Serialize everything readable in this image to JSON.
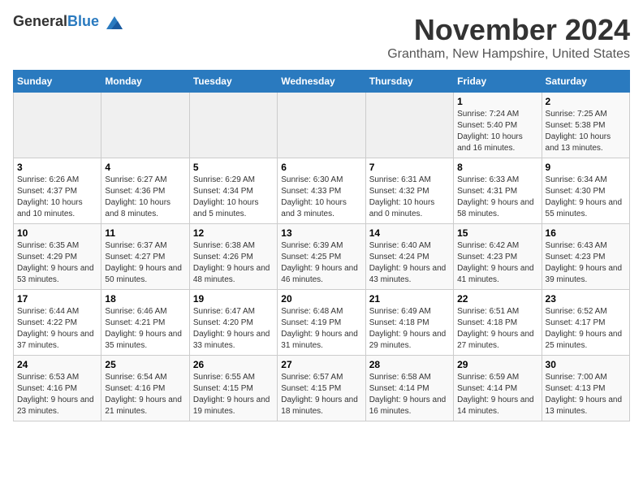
{
  "header": {
    "logo_general": "General",
    "logo_blue": "Blue",
    "month_title": "November 2024",
    "location": "Grantham, New Hampshire, United States"
  },
  "weekdays": [
    "Sunday",
    "Monday",
    "Tuesday",
    "Wednesday",
    "Thursday",
    "Friday",
    "Saturday"
  ],
  "weeks": [
    [
      {
        "day": "",
        "info": ""
      },
      {
        "day": "",
        "info": ""
      },
      {
        "day": "",
        "info": ""
      },
      {
        "day": "",
        "info": ""
      },
      {
        "day": "",
        "info": ""
      },
      {
        "day": "1",
        "info": "Sunrise: 7:24 AM\nSunset: 5:40 PM\nDaylight: 10 hours and 16 minutes."
      },
      {
        "day": "2",
        "info": "Sunrise: 7:25 AM\nSunset: 5:38 PM\nDaylight: 10 hours and 13 minutes."
      }
    ],
    [
      {
        "day": "3",
        "info": "Sunrise: 6:26 AM\nSunset: 4:37 PM\nDaylight: 10 hours and 10 minutes."
      },
      {
        "day": "4",
        "info": "Sunrise: 6:27 AM\nSunset: 4:36 PM\nDaylight: 10 hours and 8 minutes."
      },
      {
        "day": "5",
        "info": "Sunrise: 6:29 AM\nSunset: 4:34 PM\nDaylight: 10 hours and 5 minutes."
      },
      {
        "day": "6",
        "info": "Sunrise: 6:30 AM\nSunset: 4:33 PM\nDaylight: 10 hours and 3 minutes."
      },
      {
        "day": "7",
        "info": "Sunrise: 6:31 AM\nSunset: 4:32 PM\nDaylight: 10 hours and 0 minutes."
      },
      {
        "day": "8",
        "info": "Sunrise: 6:33 AM\nSunset: 4:31 PM\nDaylight: 9 hours and 58 minutes."
      },
      {
        "day": "9",
        "info": "Sunrise: 6:34 AM\nSunset: 4:30 PM\nDaylight: 9 hours and 55 minutes."
      }
    ],
    [
      {
        "day": "10",
        "info": "Sunrise: 6:35 AM\nSunset: 4:29 PM\nDaylight: 9 hours and 53 minutes."
      },
      {
        "day": "11",
        "info": "Sunrise: 6:37 AM\nSunset: 4:27 PM\nDaylight: 9 hours and 50 minutes."
      },
      {
        "day": "12",
        "info": "Sunrise: 6:38 AM\nSunset: 4:26 PM\nDaylight: 9 hours and 48 minutes."
      },
      {
        "day": "13",
        "info": "Sunrise: 6:39 AM\nSunset: 4:25 PM\nDaylight: 9 hours and 46 minutes."
      },
      {
        "day": "14",
        "info": "Sunrise: 6:40 AM\nSunset: 4:24 PM\nDaylight: 9 hours and 43 minutes."
      },
      {
        "day": "15",
        "info": "Sunrise: 6:42 AM\nSunset: 4:23 PM\nDaylight: 9 hours and 41 minutes."
      },
      {
        "day": "16",
        "info": "Sunrise: 6:43 AM\nSunset: 4:23 PM\nDaylight: 9 hours and 39 minutes."
      }
    ],
    [
      {
        "day": "17",
        "info": "Sunrise: 6:44 AM\nSunset: 4:22 PM\nDaylight: 9 hours and 37 minutes."
      },
      {
        "day": "18",
        "info": "Sunrise: 6:46 AM\nSunset: 4:21 PM\nDaylight: 9 hours and 35 minutes."
      },
      {
        "day": "19",
        "info": "Sunrise: 6:47 AM\nSunset: 4:20 PM\nDaylight: 9 hours and 33 minutes."
      },
      {
        "day": "20",
        "info": "Sunrise: 6:48 AM\nSunset: 4:19 PM\nDaylight: 9 hours and 31 minutes."
      },
      {
        "day": "21",
        "info": "Sunrise: 6:49 AM\nSunset: 4:18 PM\nDaylight: 9 hours and 29 minutes."
      },
      {
        "day": "22",
        "info": "Sunrise: 6:51 AM\nSunset: 4:18 PM\nDaylight: 9 hours and 27 minutes."
      },
      {
        "day": "23",
        "info": "Sunrise: 6:52 AM\nSunset: 4:17 PM\nDaylight: 9 hours and 25 minutes."
      }
    ],
    [
      {
        "day": "24",
        "info": "Sunrise: 6:53 AM\nSunset: 4:16 PM\nDaylight: 9 hours and 23 minutes."
      },
      {
        "day": "25",
        "info": "Sunrise: 6:54 AM\nSunset: 4:16 PM\nDaylight: 9 hours and 21 minutes."
      },
      {
        "day": "26",
        "info": "Sunrise: 6:55 AM\nSunset: 4:15 PM\nDaylight: 9 hours and 19 minutes."
      },
      {
        "day": "27",
        "info": "Sunrise: 6:57 AM\nSunset: 4:15 PM\nDaylight: 9 hours and 18 minutes."
      },
      {
        "day": "28",
        "info": "Sunrise: 6:58 AM\nSunset: 4:14 PM\nDaylight: 9 hours and 16 minutes."
      },
      {
        "day": "29",
        "info": "Sunrise: 6:59 AM\nSunset: 4:14 PM\nDaylight: 9 hours and 14 minutes."
      },
      {
        "day": "30",
        "info": "Sunrise: 7:00 AM\nSunset: 4:13 PM\nDaylight: 9 hours and 13 minutes."
      }
    ]
  ]
}
